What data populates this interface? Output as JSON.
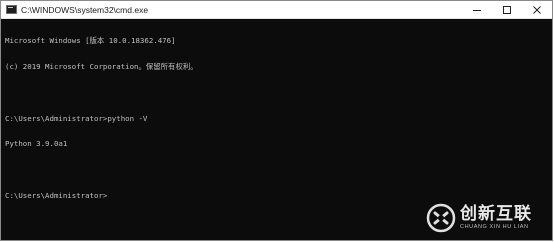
{
  "window": {
    "title": "C:\\WINDOWS\\system32\\cmd.exe",
    "icon": "cmd-icon",
    "controls": [
      "minimize-icon",
      "maximize-icon",
      "close-icon"
    ]
  },
  "console": {
    "lines": [
      "Microsoft Windows [版本 10.0.18362.476]",
      "(c) 2019 Microsoft Corporation。保留所有权利。",
      "",
      "C:\\Users\\Administrator>python -V",
      "Python 3.9.0a1",
      "",
      "C:\\Users\\Administrator>"
    ]
  },
  "watermark": {
    "main": "创新互联",
    "sub": "CHUANG XIN HU LIAN"
  },
  "colors": {
    "console_bg": "#0c0c0c",
    "console_text": "#c0c0c0",
    "titlebar_bg": "#ffffff"
  }
}
